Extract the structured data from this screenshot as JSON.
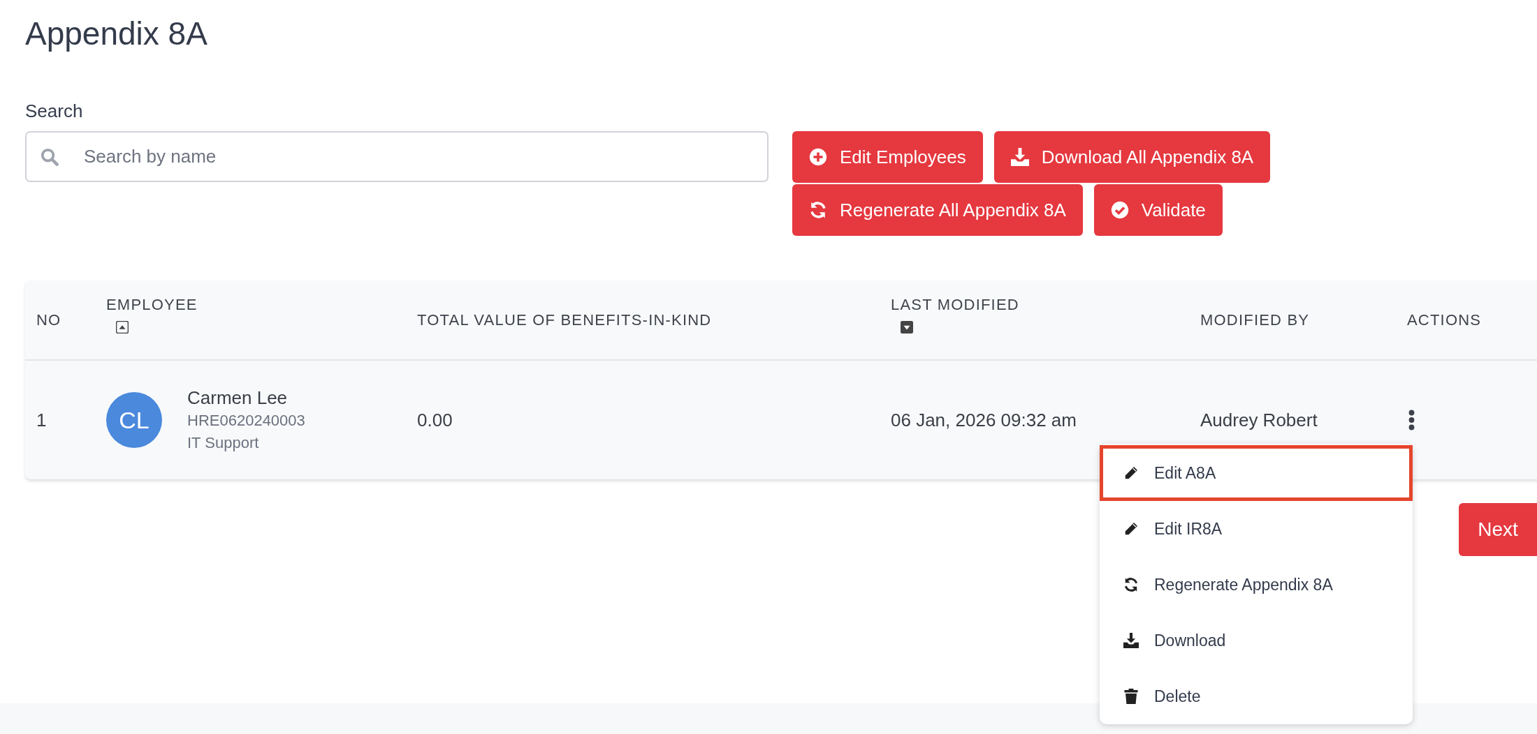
{
  "page": {
    "title": "Appendix 8A"
  },
  "search": {
    "label": "Search",
    "placeholder": "Search by name"
  },
  "toolbar": [
    {
      "kind": "plus",
      "label": "Edit Employees"
    },
    {
      "kind": "download",
      "label": "Download All Appendix 8A"
    },
    {
      "kind": "refresh",
      "label": "Regenerate All Appendix 8A"
    },
    {
      "kind": "check",
      "label": "Validate"
    }
  ],
  "table": {
    "columns": [
      {
        "label": "NO",
        "kind": "plain"
      },
      {
        "label": "EMPLOYEE",
        "kind": "sort_asc"
      },
      {
        "label": "TOTAL VALUE OF BENEFITS-IN-KIND",
        "kind": "plain"
      },
      {
        "label": "LAST MODIFIED",
        "kind": "sort_desc"
      },
      {
        "label": "MODIFIED BY",
        "kind": "plain"
      },
      {
        "label": "ACTIONS",
        "kind": "plain"
      }
    ],
    "rows": [
      {
        "no": "1",
        "initials": "CL",
        "name": "Carmen Lee",
        "employee_id": "HRE0620240003",
        "department": "IT Support",
        "total_value": "0.00",
        "last_modified": "06 Jan, 2026 09:32 am",
        "modified_by": "Audrey Robert",
        "menu": [
          {
            "kind": "edit",
            "label": "Edit A8A",
            "highlighted": true
          },
          {
            "kind": "edit",
            "label": "Edit IR8A",
            "highlighted": false
          },
          {
            "kind": "refresh",
            "label": "Regenerate Appendix 8A",
            "highlighted": false
          },
          {
            "kind": "download",
            "label": "Download",
            "highlighted": false
          },
          {
            "kind": "delete",
            "label": "Delete",
            "highlighted": false
          }
        ]
      }
    ]
  },
  "pagination": {
    "next": "Next"
  }
}
